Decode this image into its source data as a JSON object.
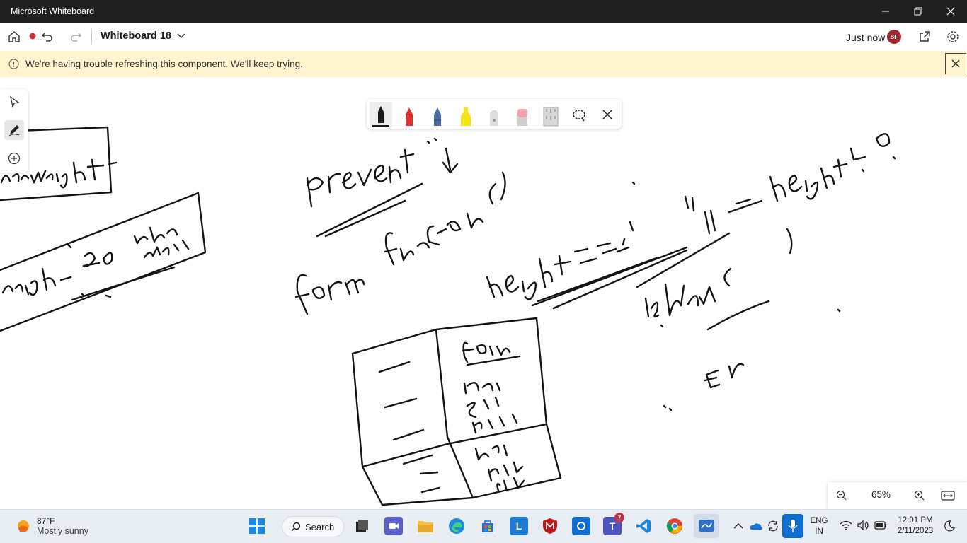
{
  "window": {
    "title": "Microsoft Whiteboard"
  },
  "appbar": {
    "board_name": "Whiteboard 18",
    "sync_status": "Just now",
    "user_initials": "SF"
  },
  "banner": {
    "message": "We're having trouble refreshing this component. We'll keep trying."
  },
  "toolbar": {
    "pens": [
      {
        "name": "black-pen",
        "color": "#1a1a1a"
      },
      {
        "name": "red-pen",
        "color": "#e03131"
      },
      {
        "name": "blue-pen",
        "color": "#4a6fa5"
      },
      {
        "name": "highlighter",
        "color": "#f7e11a"
      },
      {
        "name": "eraser",
        "color": "#d0d0d0"
      },
      {
        "name": "pink-eraser",
        "color": "#f2a3a8"
      },
      {
        "name": "ruler",
        "color": "#cfcfcf"
      }
    ]
  },
  "canvas": {
    "ink_words": [
      "preventer",
      "form function ( )",
      "height === ''",
      "|| height < 0",
      "isNaN (",
      ")",
      "form",
      "Name",
      "Email",
      "PhoneNu",
      "User",
      "PSW",
      "CFM",
      "E n",
      "underweight",
      "weight - 20 under weight"
    ]
  },
  "zoom": {
    "level": "65%"
  },
  "taskbar": {
    "weather_temp": "87°F",
    "weather_desc": "Mostly sunny",
    "search_label": "Search",
    "teams_badge": "7",
    "lang_top": "ENG",
    "lang_bottom": "IN",
    "time": "12:01 PM",
    "date": "2/11/2023"
  }
}
